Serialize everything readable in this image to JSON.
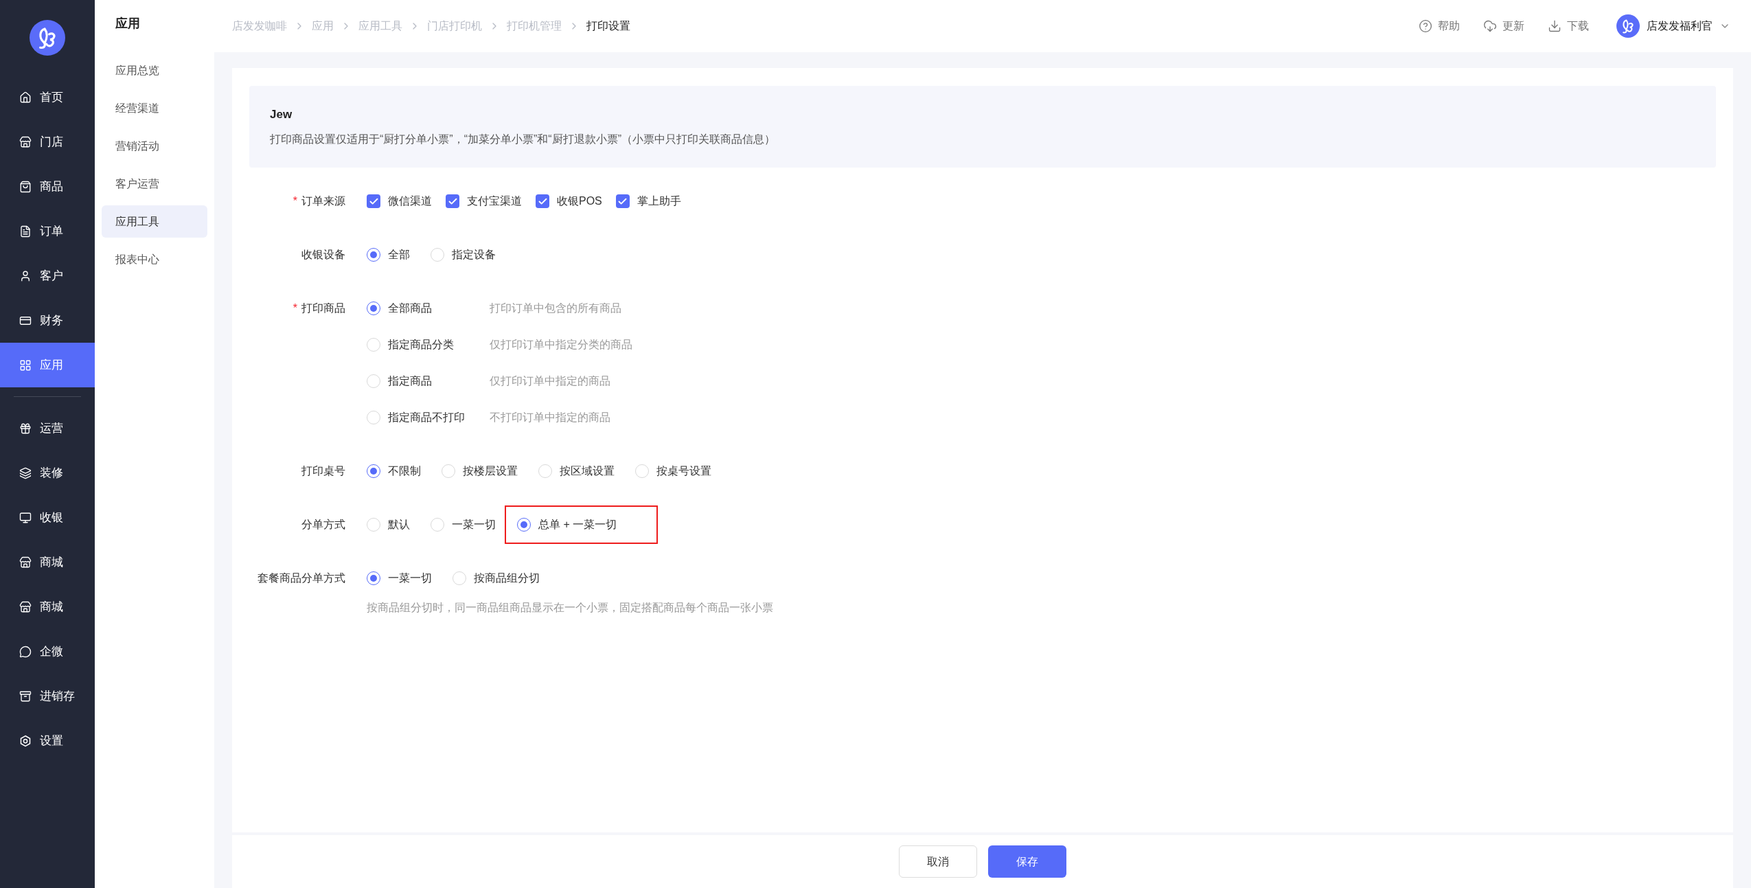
{
  "sidebar": {
    "sections": [
      {
        "items": [
          {
            "label": "首页",
            "selected": false
          },
          {
            "label": "门店",
            "selected": false
          },
          {
            "label": "商品",
            "selected": false
          },
          {
            "label": "订单",
            "selected": false
          },
          {
            "label": "客户",
            "selected": false
          },
          {
            "label": "财务",
            "selected": false
          },
          {
            "label": "应用",
            "selected": true
          }
        ]
      },
      {
        "items": [
          {
            "label": "运营",
            "selected": false
          },
          {
            "label": "装修",
            "selected": false
          },
          {
            "label": "收银",
            "selected": false
          },
          {
            "label": "商城",
            "selected": false
          },
          {
            "label": "商城",
            "selected": false
          },
          {
            "label": "企微",
            "selected": false
          },
          {
            "label": "进销存",
            "selected": false
          },
          {
            "label": "设置",
            "selected": false
          }
        ]
      }
    ]
  },
  "subnav": {
    "title": "应用",
    "items": [
      {
        "label": "应用总览",
        "selected": false
      },
      {
        "label": "经营渠道",
        "selected": false
      },
      {
        "label": "营销活动",
        "selected": false
      },
      {
        "label": "客户运营",
        "selected": false
      },
      {
        "label": "应用工具",
        "selected": true
      },
      {
        "label": "报表中心",
        "selected": false
      }
    ]
  },
  "breadcrumb": [
    {
      "label": "店发发咖啡",
      "current": false
    },
    {
      "label": "应用",
      "current": false
    },
    {
      "label": "应用工具",
      "current": false
    },
    {
      "label": "门店打印机",
      "current": false
    },
    {
      "label": "打印机管理",
      "current": false
    },
    {
      "label": "打印设置",
      "current": true
    }
  ],
  "toolbar": [
    {
      "label": "帮助"
    },
    {
      "label": "更新"
    },
    {
      "label": "下载"
    }
  ],
  "user": {
    "name": "店发发福利官"
  },
  "notice": {
    "title": "Jew",
    "text": "打印商品设置仅适用于“厨打分单小票”，“加菜分单小票”和“厨打退款小票”（小票中只打印关联商品信息）"
  },
  "form": {
    "fields": [
      {
        "label": "订单来源",
        "required_mark": "*",
        "kind": "checkboxes",
        "options": [
          {
            "label": "微信渠道",
            "checked": true
          },
          {
            "label": "支付宝渠道",
            "checked": true
          },
          {
            "label": "收银POS",
            "checked": true
          },
          {
            "label": "掌上助手",
            "checked": true
          }
        ]
      },
      {
        "label": "收银设备",
        "kind": "radios",
        "options": [
          {
            "label": "全部",
            "selected": true
          },
          {
            "label": "指定设备",
            "selected": false
          }
        ]
      },
      {
        "label": "打印商品",
        "required_mark": "*",
        "kind": "radio_list",
        "options": [
          {
            "label": "全部商品",
            "selected": true,
            "hint": "打印订单中包含的所有商品"
          },
          {
            "label": "指定商品分类",
            "selected": false,
            "hint": "仅打印订单中指定分类的商品"
          },
          {
            "label": "指定商品",
            "selected": false,
            "hint": "仅打印订单中指定的商品"
          },
          {
            "label": "指定商品不打印",
            "selected": false,
            "hint": "不打印订单中指定的商品"
          }
        ]
      },
      {
        "label": "打印桌号",
        "kind": "radios",
        "options": [
          {
            "label": "不限制",
            "selected": true
          },
          {
            "label": "按楼层设置",
            "selected": false
          },
          {
            "label": "按区域设置",
            "selected": false
          },
          {
            "label": "按桌号设置",
            "selected": false
          }
        ]
      },
      {
        "label": "分单方式",
        "kind": "radios",
        "options": [
          {
            "label": "默认",
            "selected": false,
            "highlighted": false
          },
          {
            "label": "一菜一切",
            "selected": false,
            "highlighted": false
          },
          {
            "label": "总单 + 一菜一切",
            "selected": true,
            "highlighted": true
          }
        ]
      },
      {
        "label": "套餐商品分单方式",
        "kind": "radios",
        "options": [
          {
            "label": "一菜一切",
            "selected": true
          },
          {
            "label": "按商品组分切",
            "selected": false
          }
        ],
        "note": "按商品组分切时，同一商品组商品显示在一个小票，固定搭配商品每个商品一张小票"
      }
    ]
  },
  "buttons": [
    {
      "label": "取消",
      "kind": "secondary"
    },
    {
      "label": "保存",
      "kind": "primary"
    }
  ]
}
